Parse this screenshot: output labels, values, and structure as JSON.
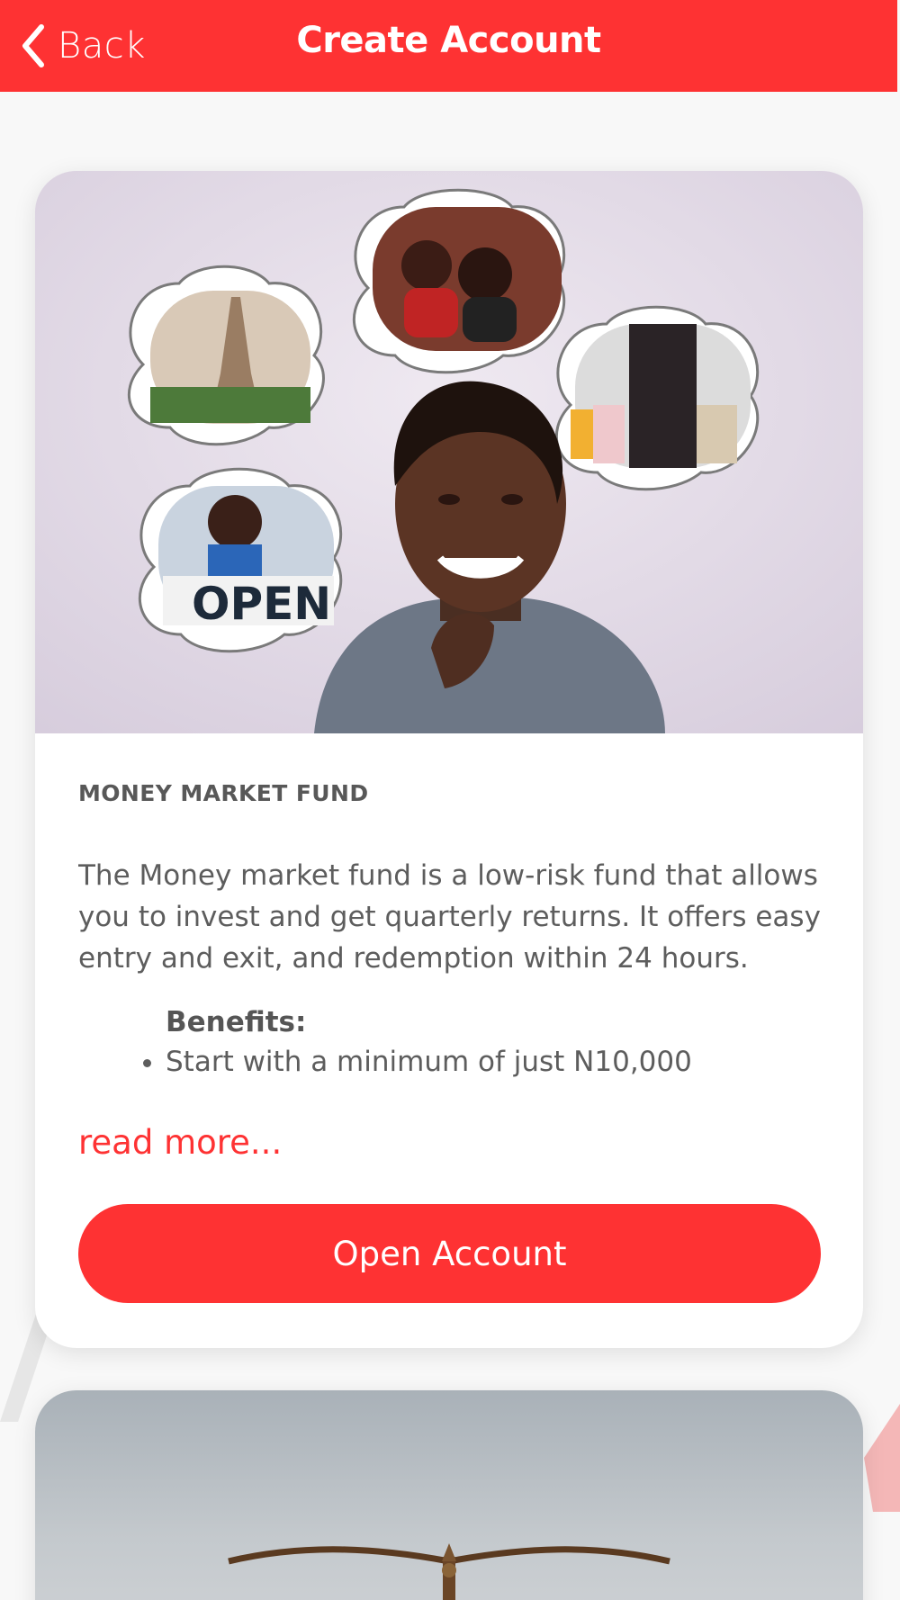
{
  "header": {
    "back_label": "Back",
    "title": "Create Account"
  },
  "cards": [
    {
      "title": "MONEY MARKET FUND",
      "description": "The Money market fund is a low-risk fund that allows you to invest and get quarterly returns. It offers easy entry and exit, and redemption within 24 hours.",
      "benefits_heading": "Benefits:",
      "benefits": [
        "Start with a minimum of just N10,000"
      ],
      "read_more": "read more...",
      "button_label": "Open Account",
      "image_bubble_open_text": "OPEN"
    }
  ],
  "colors": {
    "brand": "#fe3233",
    "background": "#f8f8f8",
    "card": "#ffffff",
    "text": "#5d5d5d"
  }
}
